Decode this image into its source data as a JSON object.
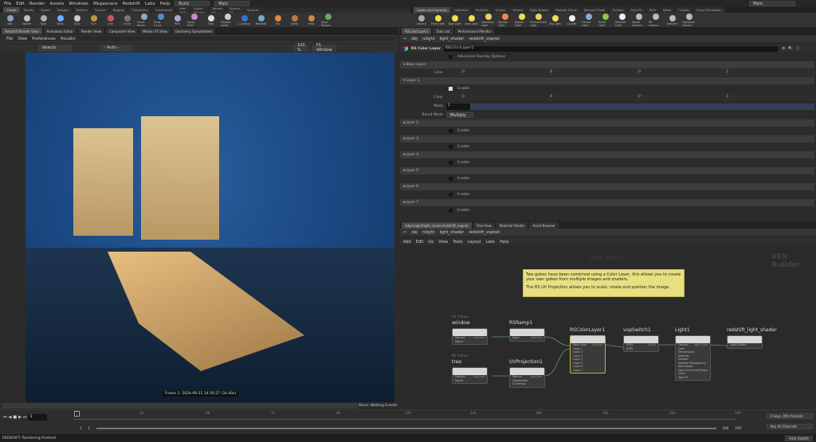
{
  "menu": {
    "items": [
      "File",
      "Edit",
      "Render",
      "Assets",
      "Windows",
      "Megascans",
      "Redshift",
      "Labs",
      "Help"
    ],
    "desktop": "Build",
    "context": "Main",
    "right_context": "Main"
  },
  "shelf_left": {
    "tabs": [
      "Create",
      "Modify",
      "Model",
      "Polygon",
      "Deform",
      "Texture",
      "Rigging",
      "Characters",
      "Constraints",
      "Hair Utils",
      "Guide Process",
      "Terrain FX",
      "Simple FX",
      "Volume"
    ],
    "tools": [
      "Box",
      "Sphere",
      "Tube",
      "Torus",
      "Grid",
      "Null",
      "Line",
      "Circle",
      "Curve Bezier",
      "Draw Curve",
      "Path",
      "Spray Paint",
      "Font",
      "Platonic Solids",
      "L-System",
      "Metaball",
      "File",
      "Spiral",
      "Helix",
      "Quick Shapes"
    ]
  },
  "shelf_right": {
    "tabs": [
      "Lights and Cameras",
      "Collisions",
      "Particles",
      "Grains",
      "Vellum",
      "Rigid Bodies",
      "Particle Fluids",
      "Viscous Fluids",
      "Oceans",
      "Pyro FX",
      "FEM",
      "Wires",
      "Crowds",
      "Drive Simulation"
    ],
    "tools": [
      "Camera",
      "Point Light",
      "Spot Light",
      "Area Light",
      "Geometry Light",
      "Volume Light",
      "Distant Light",
      "Environment Light",
      "Sky Light",
      "GI Light",
      "Caustic Light",
      "Portal Light",
      "Ambient Light",
      "Stereo Camera",
      "VR Camera",
      "Switcher",
      "Gamepad Camera"
    ]
  },
  "viewer": {
    "tabs": [
      "Redshift Render View",
      "Animation Editor",
      "Render View",
      "Composite View",
      "Motion FX View",
      "Geometry Spreadsheet"
    ],
    "menu": [
      "File",
      "View",
      "Preferences",
      "Houdini"
    ],
    "aov": "beauty",
    "auto": "- Auto -",
    "zoom": "100 %",
    "fit": "Fit Window",
    "frame_info": "Frame 1: 2024-09-21 14:56:27 (34.40s)",
    "status": "Done: Waiting Events"
  },
  "params": {
    "tabs": [
      "RSColorLayer1",
      "Take List",
      "Performance Monitor"
    ],
    "path": [
      "obj",
      "rslight",
      "light_shader",
      "redshift_vopnet"
    ],
    "node_type": "RS Color Layer",
    "node_name": "RSColorLayer1",
    "advanced": "Advanced Overlay Options",
    "base_layer": "Base Layer",
    "color_label": "Color",
    "base_color": [
      "0",
      "0",
      "0",
      "1"
    ],
    "layer1": "Layer 1",
    "enable": "Enable",
    "mask_label": "Mask",
    "mask_value": "1",
    "blend_label": "Blend Mode",
    "blend_value": "Multiply",
    "layer1_color": [
      "0",
      "0",
      "0",
      "1"
    ],
    "other_layers": [
      "Layer 2",
      "Layer 3",
      "Layer 4",
      "Layer 5",
      "Layer 6",
      "Layer 7"
    ]
  },
  "network": {
    "tabs": [
      "/obj/rslight/light_shader/redshift_vopnet",
      "Tree View",
      "Material Palette",
      "Asset Browser"
    ],
    "path": [
      "obj",
      "rslight",
      "light_shader",
      "redshift_vopnet"
    ],
    "menu": [
      "Add",
      "Edit",
      "Go",
      "View",
      "Tools",
      "Layout",
      "Labs",
      "Help"
    ],
    "watermark_edition": "Indie Edition",
    "watermark_context": "VEX Builder",
    "note": [
      "Two gobos have been combined using a Color Layer, this allows you to create your own gobos from multiple images and shaders.",
      "The RS UV Projection allows you to scale, rotate and position the image."
    ],
    "nodes": [
      {
        "sub": "RS Texture",
        "name": "window",
        "inputs": [
          "General",
          "Adjust"
        ],
        "out": "outColor"
      },
      {
        "sub": "",
        "name": "RSRamp1",
        "inputs": [
          "Input"
        ],
        "out": "outColor"
      },
      {
        "sub": "RS Texture",
        "name": "tree",
        "inputs": [
          "General",
          "Adjust"
        ],
        "out": "outColor"
      },
      {
        "sub": "",
        "name": "UVProjection1",
        "inputs": [
          "Texture",
          "Coordinates",
          "UV Remap"
        ],
        "out": "outColor"
      },
      {
        "sub": "",
        "name": "RSColorLayer1",
        "inputs": [
          "Base Layer",
          "Layer 1",
          "Layer 2",
          "Layer 3",
          "Layer 4",
          "Layer 5",
          "Layer 6",
          "Layer 7"
        ],
        "out": "outColor"
      },
      {
        "sub": "",
        "name": "vopSwitch1",
        "inputs": [
          "VOP1",
          "VOP2"
        ],
        "out": "outVal"
      },
      {
        "sub": "",
        "name": "Light1",
        "inputs": [
          "General",
          "Color",
          "Temperature",
          "Intensity",
          "Shadow",
          "Shadow Transparency",
          "Attenuation",
          "Spot Cone Falloff Angle",
          "Other",
          "Spot FX"
        ],
        "out": "Light Color"
      },
      {
        "sub": "",
        "name": "redshift_light_shader",
        "inputs": [
          "Light Shader"
        ],
        "out": ""
      }
    ]
  },
  "timeline": {
    "ticks": [
      "24",
      "48",
      "72",
      "96",
      "120",
      "144",
      "168",
      "192",
      "216",
      "240"
    ],
    "current_frame": "1",
    "start": "1",
    "start2": "1",
    "end": "240",
    "end2": "240",
    "keys": "0 keys, 0/0 channels",
    "key_all": "Key All Channels"
  },
  "status": {
    "message": "REDSHIFT: Rendering finished",
    "auto_update": "Auto Update"
  },
  "colors": {
    "accent_node": "#c8b040",
    "note_bg": "#e8e080",
    "wall": "#1f4d8a",
    "sun": "#e8c080"
  }
}
